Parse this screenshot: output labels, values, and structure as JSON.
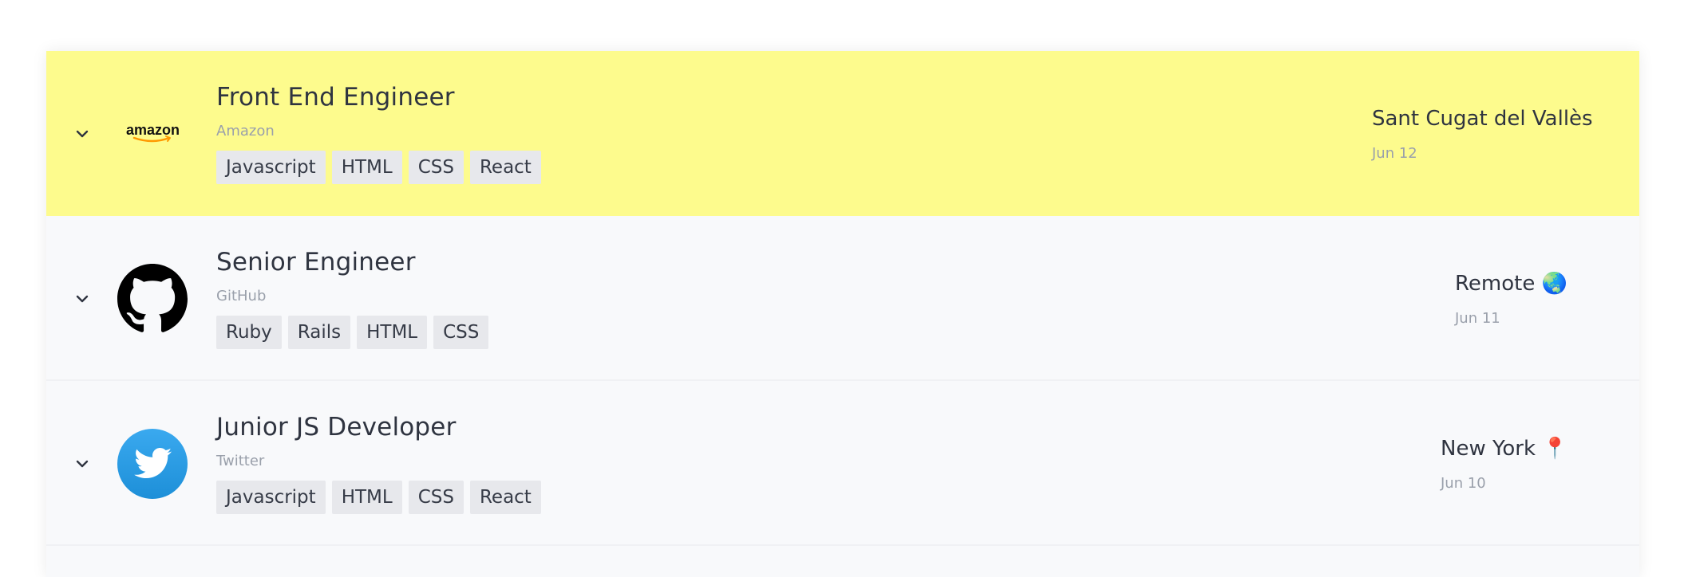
{
  "jobs": [
    {
      "title": "Front End Engineer",
      "company": "Amazon",
      "logo": "amazon-logo",
      "logo_text": "amazon",
      "tags": [
        "Javascript",
        "HTML",
        "CSS",
        "React"
      ],
      "location": "Sant Cugat del Vallès",
      "date": "Jun 12",
      "highlighted": true,
      "highlight_color": "#fdfb8d"
    },
    {
      "title": "Senior Engineer",
      "company": "GitHub",
      "logo": "github-logo",
      "tags": [
        "Ruby",
        "Rails",
        "HTML",
        "CSS"
      ],
      "location": "Remote 🌏",
      "date": "Jun 11",
      "highlighted": false
    },
    {
      "title": "Junior JS Developer",
      "company": "Twitter",
      "logo": "twitter-logo",
      "tags": [
        "Javascript",
        "HTML",
        "CSS",
        "React"
      ],
      "location": "New York 📍",
      "date": "Jun 10",
      "highlighted": false
    }
  ],
  "icons": {
    "expand": "chevron-down-icon"
  },
  "colors": {
    "highlight": "#fdfb8d",
    "twitter_blue": "#1da1f2",
    "amazon_orange": "#ff9900"
  }
}
